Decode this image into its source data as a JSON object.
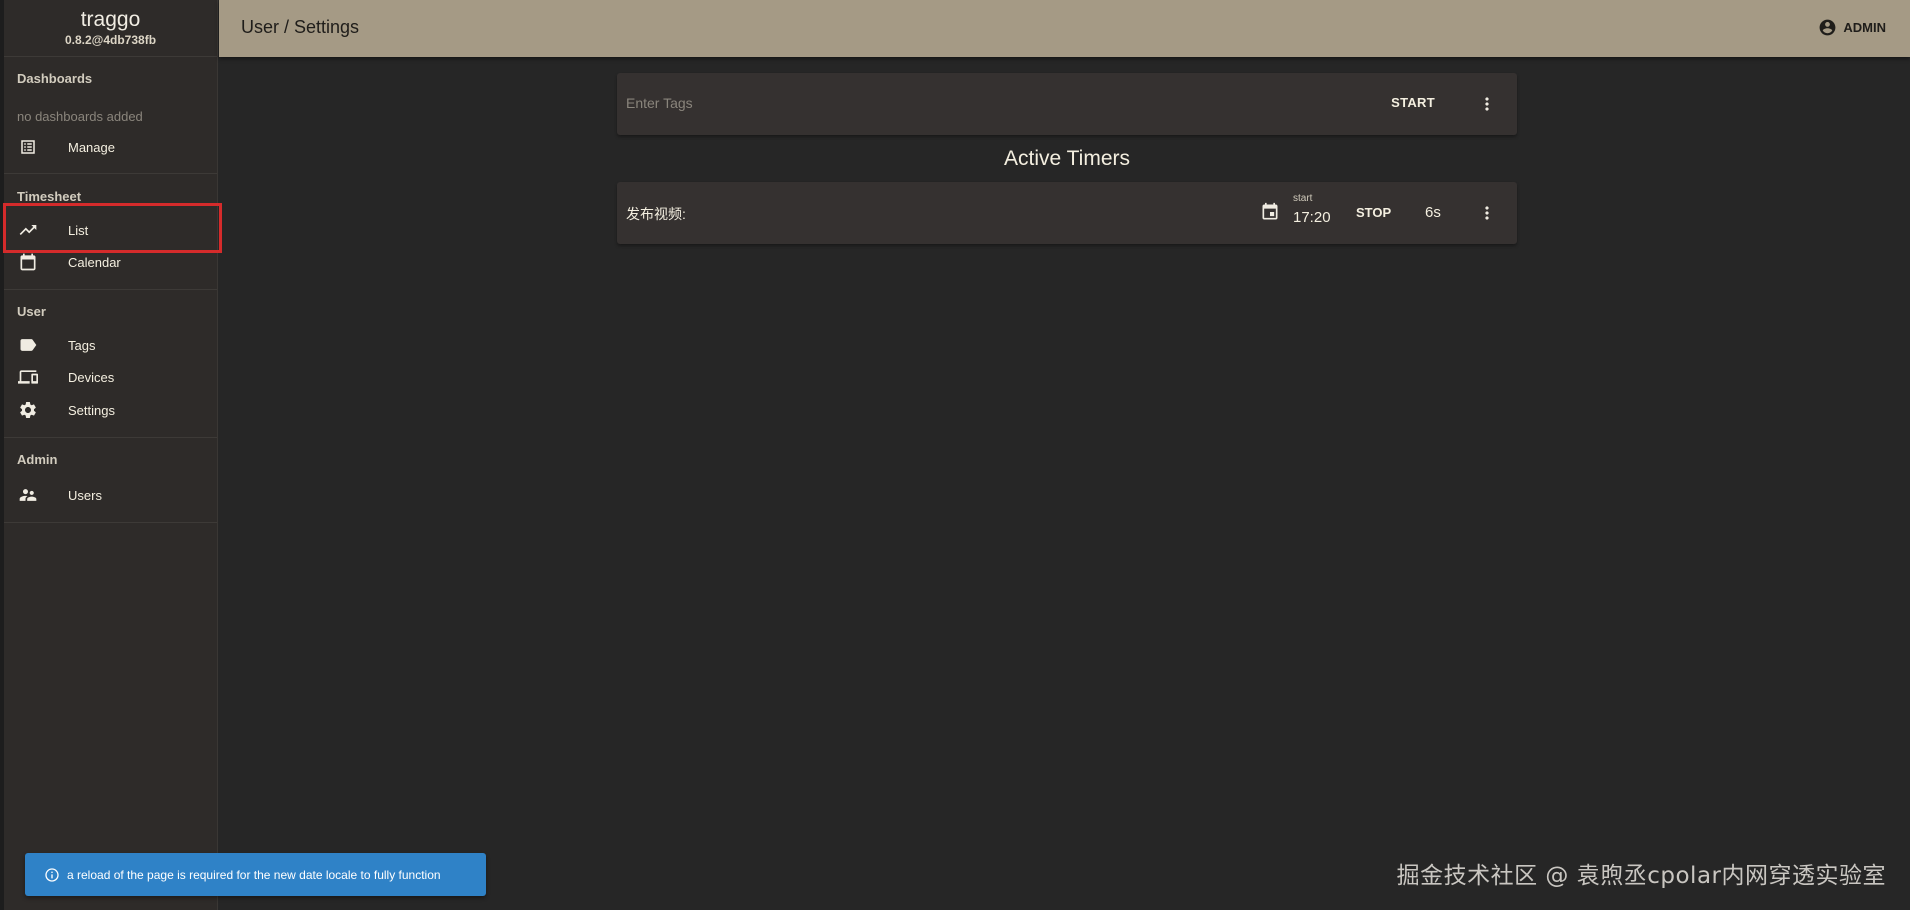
{
  "app": {
    "name": "traggo",
    "version": "0.8.2@4db738fb"
  },
  "sidebar": {
    "dashboards": {
      "title": "Dashboards",
      "empty_text": "no dashboards added",
      "items": [
        {
          "label": "Manage",
          "icon": "table-list-icon"
        }
      ]
    },
    "timesheet": {
      "title": "Timesheet",
      "items": [
        {
          "label": "List",
          "icon": "trending-line-icon"
        },
        {
          "label": "Calendar",
          "icon": "calendar-icon"
        }
      ]
    },
    "user": {
      "title": "User",
      "items": [
        {
          "label": "Tags",
          "icon": "tag-icon"
        },
        {
          "label": "Devices",
          "icon": "devices-icon"
        },
        {
          "label": "Settings",
          "icon": "gear-icon"
        }
      ]
    },
    "admin": {
      "title": "Admin",
      "items": [
        {
          "label": "Users",
          "icon": "users-icon"
        }
      ]
    }
  },
  "header": {
    "breadcrumb": "User / Settings",
    "account_label": "ADMIN"
  },
  "tag_input": {
    "placeholder": "Enter Tags",
    "start_label": "START"
  },
  "active_timers": {
    "title": "Active Timers",
    "timers": [
      {
        "tags": "发布视频:",
        "start_label": "start",
        "start_time": "17:20",
        "stop_label": "STOP",
        "elapsed": "6s"
      }
    ]
  },
  "notification": {
    "message": "a reload of the page is required for the new date locale to fully function"
  },
  "watermark": "掘金技术社区 @ 袁煦丞cpolar内网穿透实验室",
  "colors": {
    "topbar": "#a59a85",
    "sidebar": "#2e2b29",
    "background": "#262626",
    "card": "#353130",
    "snackbar": "#2f82c7",
    "highlight": "#d52b2b"
  }
}
